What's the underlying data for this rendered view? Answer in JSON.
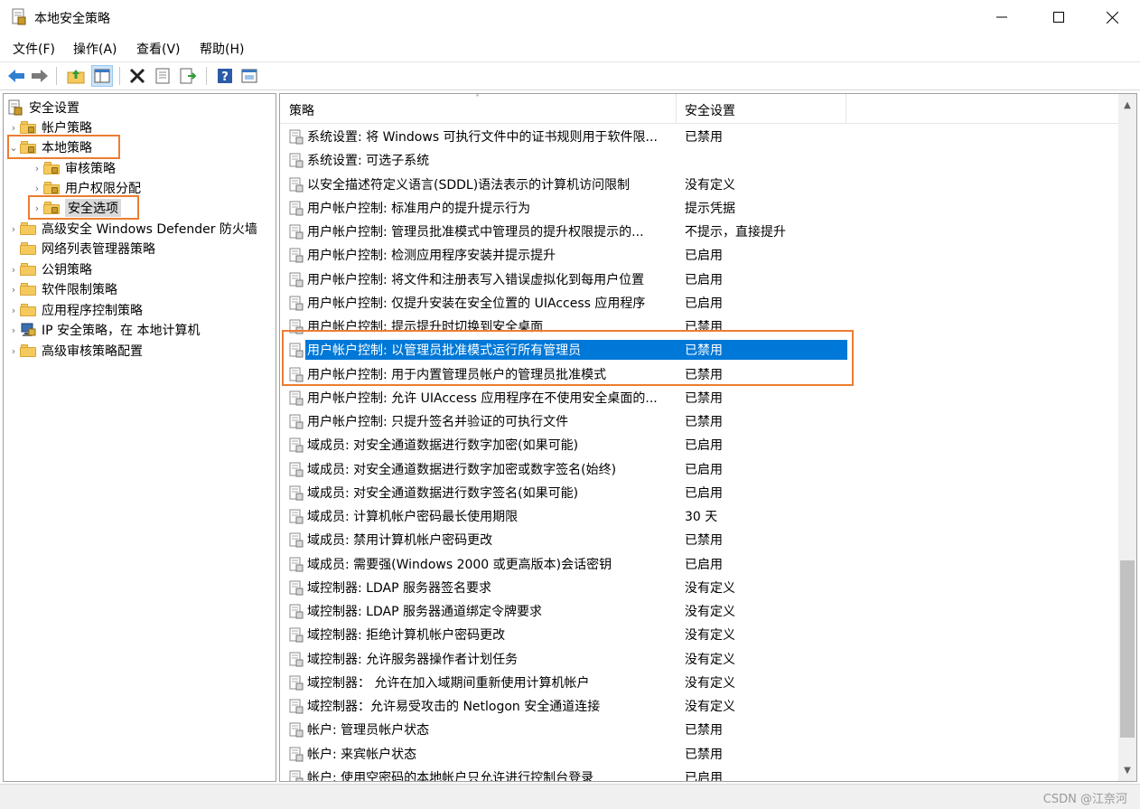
{
  "window": {
    "title": "本地安全策略",
    "controls": {
      "minimize": "minimize-icon",
      "maximize": "maximize-icon",
      "close": "close-icon"
    }
  },
  "menu": {
    "items": [
      "文件(F)",
      "操作(A)",
      "查看(V)",
      "帮助(H)"
    ]
  },
  "toolbar": {
    "buttons": [
      "back-arrow-icon",
      "forward-arrow-icon",
      "up-folder-icon",
      "show-hide-tree-icon",
      "delete-icon",
      "properties-icon",
      "export-list-icon",
      "help-icon",
      "view-icon"
    ]
  },
  "tree": {
    "root": "安全设置",
    "items": [
      {
        "label": "帐户策略",
        "level": 1,
        "expanded": false,
        "has_children": true
      },
      {
        "label": "本地策略",
        "level": 1,
        "expanded": true,
        "has_children": true
      },
      {
        "label": "审核策略",
        "level": 2,
        "expanded": false,
        "has_children": true
      },
      {
        "label": "用户权限分配",
        "level": 2,
        "expanded": false,
        "has_children": true
      },
      {
        "label": "安全选项",
        "level": 2,
        "expanded": false,
        "has_children": true,
        "selected": true
      },
      {
        "label": "高级安全 Windows Defender 防火墙",
        "level": 1,
        "expanded": false,
        "has_children": true
      },
      {
        "label": "网络列表管理器策略",
        "level": 1,
        "expanded": false,
        "has_children": false
      },
      {
        "label": "公钥策略",
        "level": 1,
        "expanded": false,
        "has_children": true
      },
      {
        "label": "软件限制策略",
        "level": 1,
        "expanded": false,
        "has_children": true
      },
      {
        "label": "应用程序控制策略",
        "level": 1,
        "expanded": false,
        "has_children": true
      },
      {
        "label": "IP 安全策略，在 本地计算机",
        "level": 1,
        "expanded": false,
        "has_children": true
      },
      {
        "label": "高级审核策略配置",
        "level": 1,
        "expanded": false,
        "has_children": true
      }
    ]
  },
  "list": {
    "columns": [
      "策略",
      "安全设置"
    ],
    "rows": [
      {
        "policy": "系统设置: 将 Windows 可执行文件中的证书规则用于软件限...",
        "setting": "已禁用"
      },
      {
        "policy": "系统设置: 可选子系统",
        "setting": ""
      },
      {
        "policy": "以安全描述符定义语言(SDDL)语法表示的计算机访问限制",
        "setting": "没有定义"
      },
      {
        "policy": "用户帐户控制: 标准用户的提升提示行为",
        "setting": "提示凭据"
      },
      {
        "policy": "用户帐户控制: 管理员批准模式中管理员的提升权限提示的...",
        "setting": "不提示，直接提升"
      },
      {
        "policy": "用户帐户控制: 检测应用程序安装并提示提升",
        "setting": "已启用"
      },
      {
        "policy": "用户帐户控制: 将文件和注册表写入错误虚拟化到每用户位置",
        "setting": "已启用"
      },
      {
        "policy": "用户帐户控制: 仅提升安装在安全位置的 UIAccess 应用程序",
        "setting": "已启用"
      },
      {
        "policy": "用户帐户控制: 提示提升时切换到安全桌面",
        "setting": "已禁用"
      },
      {
        "policy": "用户帐户控制: 以管理员批准模式运行所有管理员",
        "setting": "已禁用",
        "selected": true
      },
      {
        "policy": "用户帐户控制: 用于内置管理员帐户的管理员批准模式",
        "setting": "已禁用"
      },
      {
        "policy": "用户帐户控制: 允许 UIAccess 应用程序在不使用安全桌面的...",
        "setting": "已禁用"
      },
      {
        "policy": "用户帐户控制: 只提升签名并验证的可执行文件",
        "setting": "已禁用"
      },
      {
        "policy": "域成员: 对安全通道数据进行数字加密(如果可能)",
        "setting": "已启用"
      },
      {
        "policy": "域成员: 对安全通道数据进行数字加密或数字签名(始终)",
        "setting": "已启用"
      },
      {
        "policy": "域成员: 对安全通道数据进行数字签名(如果可能)",
        "setting": "已启用"
      },
      {
        "policy": "域成员: 计算机帐户密码最长使用期限",
        "setting": "30 天"
      },
      {
        "policy": "域成员: 禁用计算机帐户密码更改",
        "setting": "已禁用"
      },
      {
        "policy": "域成员: 需要强(Windows 2000 或更高版本)会话密钥",
        "setting": "已启用"
      },
      {
        "policy": "域控制器: LDAP 服务器签名要求",
        "setting": "没有定义"
      },
      {
        "policy": "域控制器: LDAP 服务器通道绑定令牌要求",
        "setting": "没有定义"
      },
      {
        "policy": "域控制器: 拒绝计算机帐户密码更改",
        "setting": "没有定义"
      },
      {
        "policy": "域控制器: 允许服务器操作者计划任务",
        "setting": "没有定义"
      },
      {
        "policy": "域控制器： 允许在加入域期间重新使用计算机帐户",
        "setting": "没有定义"
      },
      {
        "policy": "域控制器：允许易受攻击的 Netlogon 安全通道连接",
        "setting": "没有定义"
      },
      {
        "policy": "帐户: 管理员帐户状态",
        "setting": "已禁用"
      },
      {
        "policy": "帐户: 来宾帐户状态",
        "setting": "已禁用"
      },
      {
        "policy": "帐户: 使用空密码的本地帐户只允许进行控制台登录",
        "setting": "已启用"
      }
    ]
  },
  "watermark": "CSDN @江奈河",
  "colors": {
    "selection": "#0078d7",
    "highlight_box": "#ed7d31",
    "folder": "#f4c95d"
  }
}
